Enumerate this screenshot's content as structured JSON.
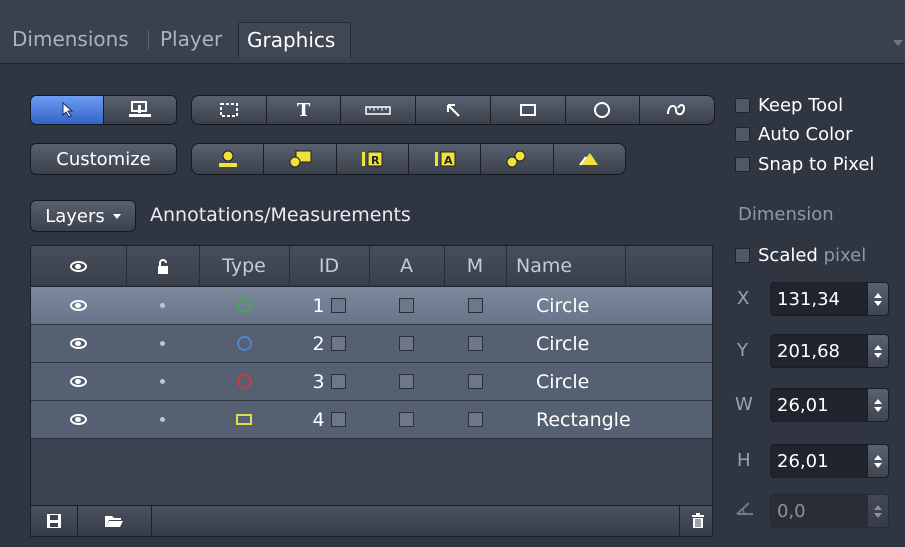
{
  "tabs": [
    {
      "label": "Dimensions",
      "active": false
    },
    {
      "label": "Player",
      "active": false
    },
    {
      "label": "Graphics",
      "active": true
    }
  ],
  "toolbar": {
    "pointer_icon": "arrow-pointer-icon",
    "select_tool_icon": "stamp-select-icon",
    "customize_label": "Customize",
    "draw_tools": [
      "marquee-icon",
      "text-icon",
      "ruler-icon",
      "arrow-icon",
      "rectangle-icon",
      "circle-icon",
      "freehand-icon"
    ],
    "text_tool_glyph": "T",
    "measure_tools": [
      "scale-bar-icon",
      "annotation-overlay-icon",
      "region-r-icon",
      "region-a-icon",
      "profile-icon",
      "angle-icon"
    ],
    "measure_glyphs": {
      "region_r": "R",
      "region_a": "A"
    },
    "options": [
      {
        "label": "Keep Tool",
        "checked": false
      },
      {
        "label": "Auto Color",
        "checked": false
      },
      {
        "label": "Snap to Pixel",
        "checked": false
      }
    ]
  },
  "layers": {
    "dropdown_label": "Layers",
    "section_title": "Annotations/Measurements",
    "columns": [
      "",
      "",
      "Type",
      "ID",
      "A",
      "M",
      "Name"
    ],
    "rows": [
      {
        "id": "1",
        "type": "circle",
        "color": "#3fae3f",
        "name": "Circle",
        "selected": true
      },
      {
        "id": "2",
        "type": "circle",
        "color": "#4f86cf",
        "name": "Circle",
        "selected": false
      },
      {
        "id": "3",
        "type": "circle",
        "color": "#d23a3a",
        "name": "Circle",
        "selected": false
      },
      {
        "id": "4",
        "type": "rectangle",
        "color": "#e6d84d",
        "name": "Rectangle",
        "selected": false
      }
    ]
  },
  "dimension": {
    "title": "Dimension",
    "scaled_label": "Scaled",
    "scaled_suffix": "pixel",
    "x_label": "X",
    "x_value": "131,34",
    "y_label": "Y",
    "y_value": "201,68",
    "w_label": "W",
    "w_value": "26,01",
    "h_label": "H",
    "h_value": "26,01",
    "angle_value": "0,0"
  }
}
